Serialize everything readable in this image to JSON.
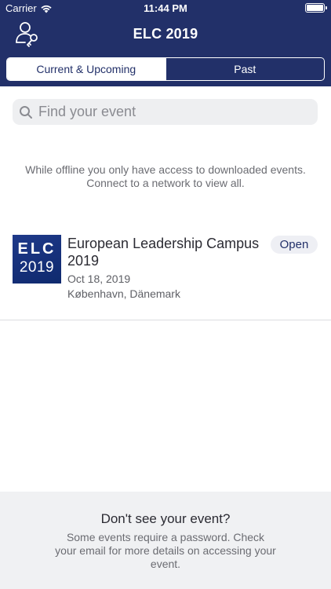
{
  "status_bar": {
    "carrier": "Carrier",
    "time": "11:44 PM"
  },
  "nav": {
    "title": "ELC 2019",
    "icon": "user-key-icon"
  },
  "tabs": [
    {
      "label": "Current & Upcoming",
      "active": true
    },
    {
      "label": "Past",
      "active": false
    }
  ],
  "search": {
    "placeholder": "Find your event",
    "value": ""
  },
  "offline_message": "While offline you only have access to downloaded events. Connect to a network to view all.",
  "events": [
    {
      "logo_line1": "ELC",
      "logo_line2": "2019",
      "title": "European Leadership Campus 2019",
      "date": "Oct 18, 2019",
      "location": "København, Dänemark",
      "badge": "Open"
    }
  ],
  "footer": {
    "title": "Don't see your event?",
    "text": "Some events require a password. Check your email for more details on accessing your event."
  },
  "colors": {
    "brand": "#223069",
    "background": "#ffffff",
    "footer_bg": "#f0f1f3"
  }
}
